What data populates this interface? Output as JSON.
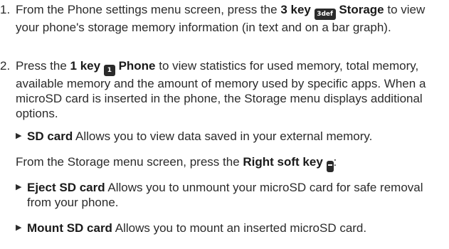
{
  "steps": [
    {
      "number": "1.",
      "pre": "From the Phone settings menu screen, press the ",
      "key_label": "3 key",
      "key_icon_text": "3def",
      "key_icon": "key-3-icon",
      "after_icon_bold": "Storage",
      "post": " to view your phone's storage memory information (in text and on a bar graph)."
    },
    {
      "number": "2.",
      "pre": "Press the ",
      "key_label": "1 key",
      "key_icon_text": "1",
      "key_icon": "key-1-icon",
      "after_icon_bold": "Phone",
      "post": " to view statistics for used memory, total memory, available memory and the amount of memory used by specific apps. When a microSD card is inserted in the phone, the Storage menu displays additional options."
    }
  ],
  "bullets_a": [
    {
      "title": "SD card",
      "desc": " Allows you to view data saved in your external memory."
    }
  ],
  "intro_b": {
    "pre": "From the Storage menu screen, press the ",
    "bold": "Right soft key",
    "icon": "right-soft-key-icon",
    "post": ":"
  },
  "bullets_b": [
    {
      "title": "Eject SD card",
      "desc": " Allows you to unmount your microSD card for safe removal from your phone."
    },
    {
      "title": "Mount SD card",
      "desc": " Allows you to mount an inserted microSD card."
    }
  ],
  "colors": {
    "text": "#2b2b2b",
    "icon_bg": "#2b2b2b"
  }
}
